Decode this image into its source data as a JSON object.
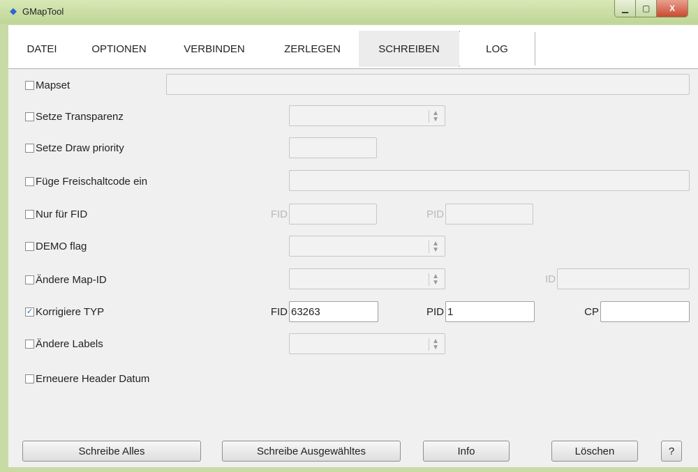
{
  "window": {
    "title": "GMapTool",
    "minimize": "▁",
    "maximize": "▢",
    "close": "X"
  },
  "tabs": [
    {
      "label": "DATEI"
    },
    {
      "label": "OPTIONEN"
    },
    {
      "label": "VERBINDEN"
    },
    {
      "label": "ZERLEGEN"
    },
    {
      "label": "SCHREIBEN"
    },
    {
      "label": "LOG"
    }
  ],
  "active_tab": "SCHREIBEN",
  "options": {
    "mapset": {
      "label": "Mapset",
      "checked": false,
      "value": ""
    },
    "transparenz": {
      "label": "Setze Transparenz",
      "checked": false,
      "value": ""
    },
    "draw_priority": {
      "label": "Setze Draw priority",
      "checked": false,
      "value": ""
    },
    "freischaltcode": {
      "label": "Füge Freischaltcode ein",
      "checked": false,
      "value": ""
    },
    "nur_fid": {
      "label": "Nur für FID",
      "checked": false,
      "fid_label": "FID",
      "fid_value": "",
      "pid_label": "PID",
      "pid_value": ""
    },
    "demo_flag": {
      "label": "DEMO flag",
      "checked": false,
      "value": ""
    },
    "map_id": {
      "label": "Ändere Map-ID",
      "checked": false,
      "value": "",
      "id_label": "ID",
      "id_value": ""
    },
    "korrigiere_typ": {
      "label": "Korrigiere TYP",
      "checked": true,
      "check_mark": "✓",
      "fid_label": "FID",
      "fid_value": "63263",
      "pid_label": "PID",
      "pid_value": "1",
      "cp_label": "CP",
      "cp_value": ""
    },
    "labels": {
      "label": "Ändere Labels",
      "checked": false,
      "value": ""
    },
    "header_datum": {
      "label": "Erneuere Header Datum",
      "checked": false
    }
  },
  "spin_arrows": {
    "up": "▲",
    "down": "▼"
  },
  "buttons": {
    "schreibe_alles": "Schreibe Alles",
    "schreibe_ausgewaehltes": "Schreibe Ausgewähltes",
    "info": "Info",
    "loeschen": "Löschen",
    "help": "?"
  },
  "colors": {
    "frame": "#c9dba5",
    "panel": "#f0f0f0",
    "checkmark": "#2b5fbf",
    "close_button": "#c94a32"
  }
}
